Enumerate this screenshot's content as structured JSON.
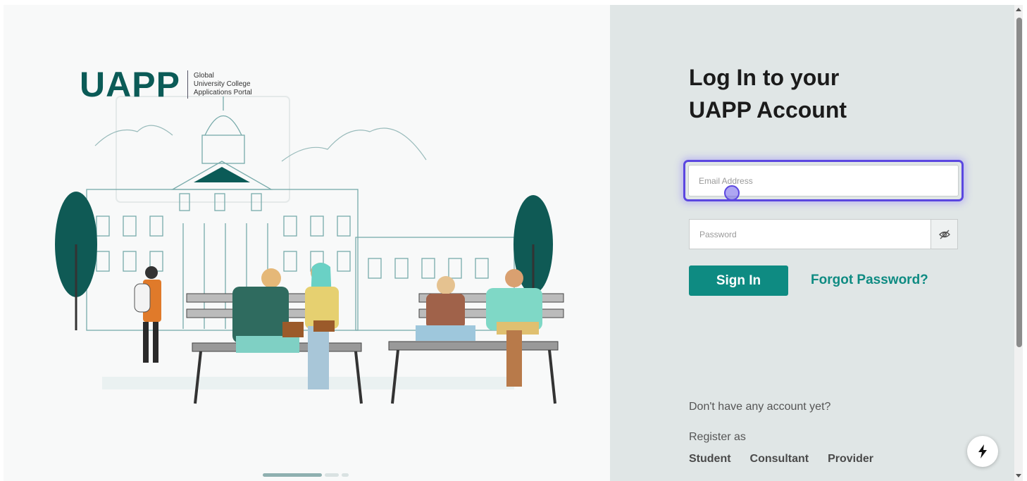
{
  "brand": {
    "logo_text": "UAPP",
    "tagline_line1": "Global",
    "tagline_line2": "University College",
    "tagline_line3": "Applications Portal"
  },
  "login": {
    "heading_line1": "Log In to your",
    "heading_line2": "UAPP Account",
    "email_placeholder": "Email Address",
    "password_placeholder": "Password",
    "password_toggle_icon": "eye-slash-icon",
    "sign_in_label": "Sign In",
    "forgot_password_label": "Forgot Password?"
  },
  "register": {
    "prompt": "Don't have any account yet?",
    "register_as": "Register as",
    "options": [
      "Student",
      "Consultant",
      "Provider"
    ]
  },
  "chat": {
    "icon": "chat-widget-icon"
  },
  "colors": {
    "brand_teal": "#0e8b82",
    "logo_dark": "#0b5b57",
    "focus_ring": "#5b47e0",
    "right_bg": "#e0e6e6"
  }
}
